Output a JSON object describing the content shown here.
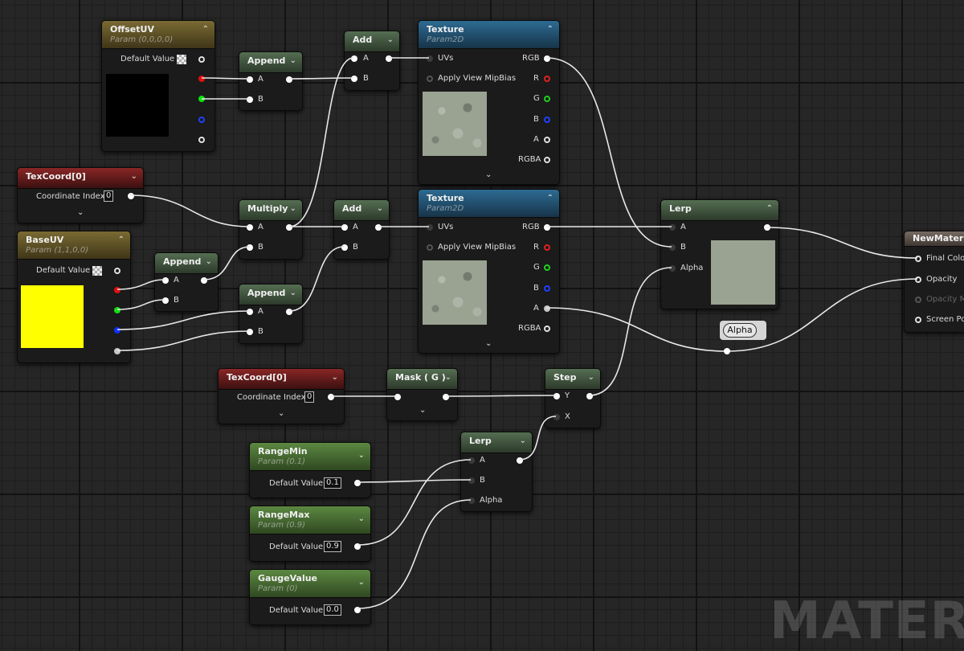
{
  "watermark": "MATERIAL",
  "nodes": {
    "offset_uv": {
      "title": "OffsetUV",
      "subtitle": "Param (0,0,0,0)",
      "default_label": "Default Value",
      "swatch_color": "#000000"
    },
    "append1": {
      "title": "Append",
      "pin_a": "A",
      "pin_b": "B"
    },
    "add1": {
      "title": "Add",
      "pin_a": "A",
      "pin_b": "B"
    },
    "texture1": {
      "title": "Texture",
      "subtitle": "Param2D",
      "uvs": "UVs",
      "mip": "Apply View MipBias",
      "rgb": "RGB",
      "r": "R",
      "g": "G",
      "b": "B",
      "a": "A",
      "rgba": "RGBA"
    },
    "texcoord1": {
      "title": "TexCoord[0]",
      "coord_label": "Coordinate Index",
      "coord_value": "0"
    },
    "multiply": {
      "title": "Multiply",
      "pin_a": "A",
      "pin_b": "B"
    },
    "add2": {
      "title": "Add",
      "pin_a": "A",
      "pin_b": "B"
    },
    "texture2": {
      "title": "Texture",
      "subtitle": "Param2D",
      "uvs": "UVs",
      "mip": "Apply View MipBias",
      "rgb": "RGB",
      "r": "R",
      "g": "G",
      "b": "B",
      "a": "A",
      "rgba": "RGBA"
    },
    "lerp1": {
      "title": "Lerp",
      "pin_a": "A",
      "pin_b": "B",
      "alpha": "Alpha"
    },
    "new_material": {
      "title": "NewMaterial",
      "final_color": "Final Color",
      "opacity": "Opacity",
      "opacity_mask": "Opacity Mask",
      "screen_pos": "Screen Position"
    },
    "base_uv": {
      "title": "BaseUV",
      "subtitle": "Param (1,1,0,0)",
      "default_label": "Default Value",
      "swatch_color": "#ffff00"
    },
    "append2": {
      "title": "Append",
      "pin_a": "A",
      "pin_b": "B"
    },
    "append3": {
      "title": "Append",
      "pin_a": "A",
      "pin_b": "B"
    },
    "alpha_reroute": {
      "label": "Alpha"
    },
    "texcoord2": {
      "title": "TexCoord[0]",
      "coord_label": "Coordinate Index",
      "coord_value": "0"
    },
    "mask": {
      "title": "Mask ( G )"
    },
    "step": {
      "title": "Step",
      "pin_y": "Y",
      "pin_x": "X"
    },
    "lerp2": {
      "title": "Lerp",
      "pin_a": "A",
      "pin_b": "B",
      "alpha": "Alpha"
    },
    "range_min": {
      "title": "RangeMin",
      "subtitle": "Param (0.1)",
      "default_label": "Default Value",
      "value": "0.1"
    },
    "range_max": {
      "title": "RangeMax",
      "subtitle": "Param (0.9)",
      "default_label": "Default Value",
      "value": "0.9"
    },
    "gauge_value": {
      "title": "GaugeValue",
      "subtitle": "Param (0)",
      "default_label": "Default Value",
      "value": "0.0"
    }
  },
  "icons": {
    "collapse": "chevron-up-icon",
    "expand": "chevron-down-icon",
    "checker": "checkerboard-icon"
  },
  "colors": {
    "param_header": "#7a6a33",
    "texcoord_header": "#8a2626",
    "math_header": "#556e52",
    "texture_header": "#2d6b92",
    "scalar_header": "#5c8841",
    "output_header": "#776a62",
    "texture_preview": "#9aa292",
    "lerp_preview": "#9aa292"
  }
}
